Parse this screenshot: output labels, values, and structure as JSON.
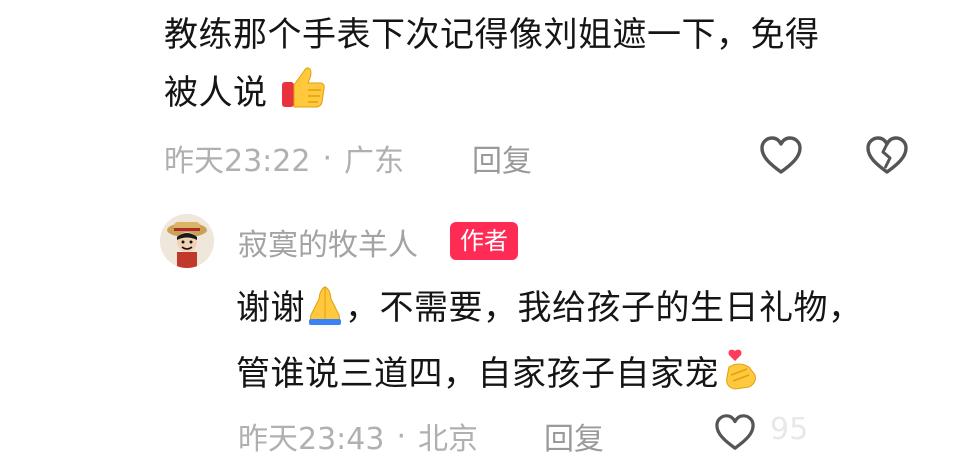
{
  "comment1": {
    "line1": "教练那个手表下次记得像刘姐遮一下，免得",
    "line2": "被人说",
    "time": "昨天23:22",
    "separator": "·",
    "location": "广东",
    "reply_label": "回复"
  },
  "comment2": {
    "username": "寂寞的牧羊人",
    "badge": "作者",
    "line1_a": "谢谢",
    "line1_b": "，不需要，我给孩子的生日礼物，",
    "line2": "管谁说三道四，自家孩子自家宠",
    "time": "昨天23:43",
    "separator": "·",
    "location": "北京",
    "reply_label": "回复",
    "like_count": "95"
  },
  "icons": {
    "thumbs_up_emoji": "thumbs-up-icon",
    "heart": "heart-icon",
    "broken_heart": "broken-heart-icon",
    "praying_hands_emoji": "praying-hands-icon",
    "finger_heart_emoji": "finger-heart-icon"
  },
  "colors": {
    "badge_bg": "#fe2c55",
    "meta_text": "#b0b0b0",
    "body_text": "#151515"
  }
}
